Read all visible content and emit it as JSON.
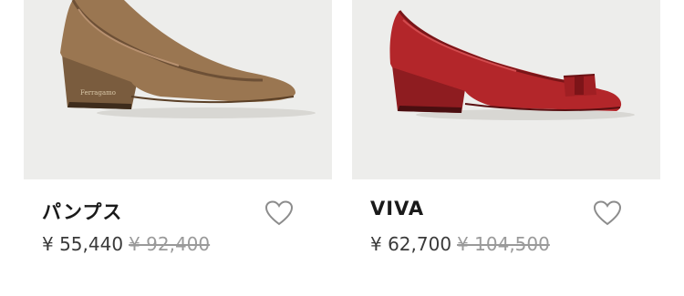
{
  "products": [
    {
      "name": "パンプス",
      "price": "¥ 55,440",
      "original_price": "¥ 92,400",
      "shoe_color": "#9a7651",
      "favorite_icon": "heart-outline-icon"
    },
    {
      "name": "VIVA",
      "price": "¥ 62,700",
      "original_price": "¥ 104,500",
      "shoe_color": "#b3262a",
      "favorite_icon": "heart-outline-icon"
    }
  ],
  "colors": {
    "image_background": "#ededeb",
    "name_text": "#1a1a1a",
    "price_text": "#3a3a3a",
    "original_price_text": "#9a9a9a"
  }
}
